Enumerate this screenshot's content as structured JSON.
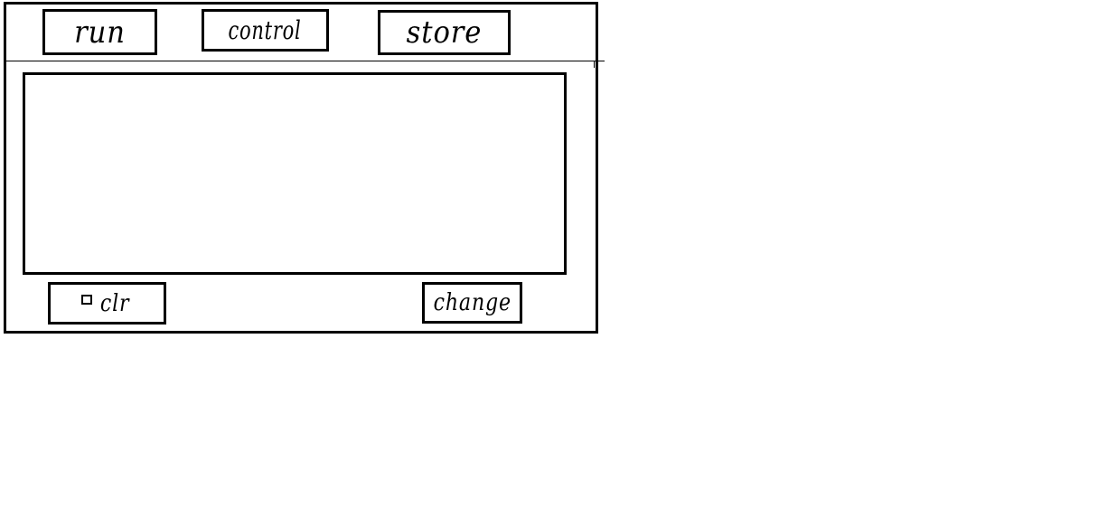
{
  "toolbar": {
    "run_label": "run",
    "control_label": "control",
    "store_label": "store"
  },
  "footer": {
    "clear_label": "clr",
    "change_label": "change"
  }
}
